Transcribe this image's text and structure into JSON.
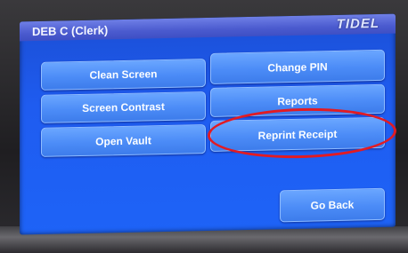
{
  "window": {
    "title": "DEB C (Clerk)",
    "logo_text": "TIDEL"
  },
  "buttons": {
    "clean_screen": "Clean Screen",
    "change_pin": "Change PIN",
    "screen_contrast": "Screen Contrast",
    "reports": "Reports",
    "open_vault": "Open Vault",
    "reprint_receipt": "Reprint Receipt",
    "go_back": "Go Back"
  },
  "colors": {
    "screen_blue": "#1f5cf0",
    "button_blue": "#4c8cf7",
    "annotation_red": "#e21b23"
  }
}
